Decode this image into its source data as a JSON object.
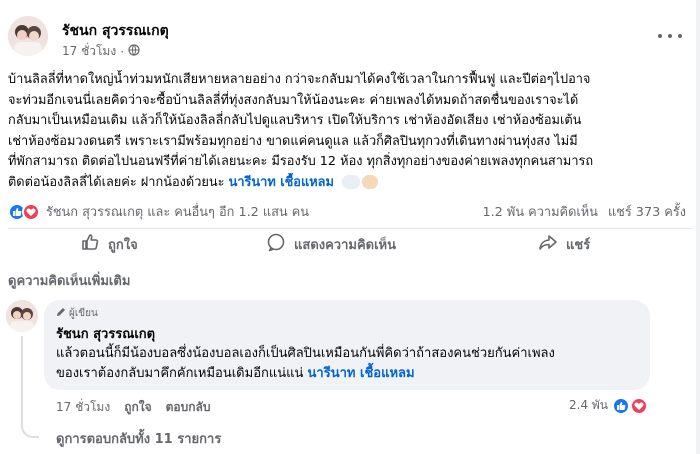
{
  "post": {
    "author": "รัชนก สุวรรณเกตุ",
    "time": "17 ชั่วโมง",
    "separator": "·",
    "privacy_icon": "globe-icon",
    "more_icon": "more-horizontal-icon",
    "body_lines": [
      "บ้านลิลลี่ที่หาดใหญ่น้ำท่วมหนักเสียหายหลายอย่าง กว่าจะกลับมาได้คงใช้เวลาในการฟื้นฟู และปีต่อๆไปอาจ",
      "จะท่วมอีกเจนนี่เลยคิดว่าจะซื้อบ้านลิลลี่ที่ทุ่งสงกลับมาให้น้องนะคะ ค่ายเพลงได้หมดถ้าสดชื่นของเราจะได้",
      "กลับมาเป็นเหมือนเดิม แล้วก็ให้น้องลิลลี่กลับไปดูแลบริหาร เปิดให้บริการ เช่าห้องอัดเสียง เช่าห้องซ้อมเต้น",
      "เช่าห้องซ้อมวงดนตรี เพราะเรามีพร้อมทุกอย่าง ขาดแค่คนดูแล แล้วก็ศิลปินทุกวงที่เดินทางผ่านทุ่งสง ไม่มี",
      "ที่พักสามารถ ติดต่อไปนอนฟรีที่ค่ายได้เลยนะคะ มีรองรับ 12 ห้อง ทุกสิ่งทุกอย่างของค่ายเพลงทุกคนสามารถ"
    ],
    "body_last_line": "ติดต่อน้องลิลลี่ได้เลยค่ะ ฝากน้องด้วยนะ",
    "body_mention": "นารีนาท เชื้อแหลม",
    "reactions_text": "รัชนก สุวรรณเกตุ และ คนอื่นๆ อีก 1.2 แสน คน",
    "comments_count": "1.2 พัน ความคิดเห็น",
    "shares_count": "แชร์ 373 ครั้ง",
    "colors": {
      "like_blue": "#1877f2",
      "love_red": "#f33e58",
      "mention_blue": "#0064d1",
      "muted": "#65676b"
    }
  },
  "actions": {
    "like": "ถูกใจ",
    "comment": "แสดงความคิดเห็น",
    "share": "แชร์"
  },
  "comments_section": {
    "view_more": "ดูความคิดเห็นเพิ่มเติม",
    "comment": {
      "badge": "ผู้เขียน",
      "author": "รัชนก สุวรรณเกตุ",
      "text_line1": "แล้วตอนนี้ก็มีน้องบอลซึ่งน้องบอลเองก็เป็นศิลปินเหมือนกันพี่คิดว่าถ้าสองคนช่วยกันค่าเพลง",
      "text_line2": "ของเราต้องกลับมาคึกคักเหมือนเดิมอีกแน่แน่",
      "mention": "นารีนาท เชื้อแหลม",
      "time": "17 ชั่วโมง",
      "like": "ถูกใจ",
      "reply": "ตอบกลับ",
      "reaction_count": "2.4 พัน",
      "view_replies": "ดูการตอบกลับทั้ง 11 รายการ"
    }
  }
}
